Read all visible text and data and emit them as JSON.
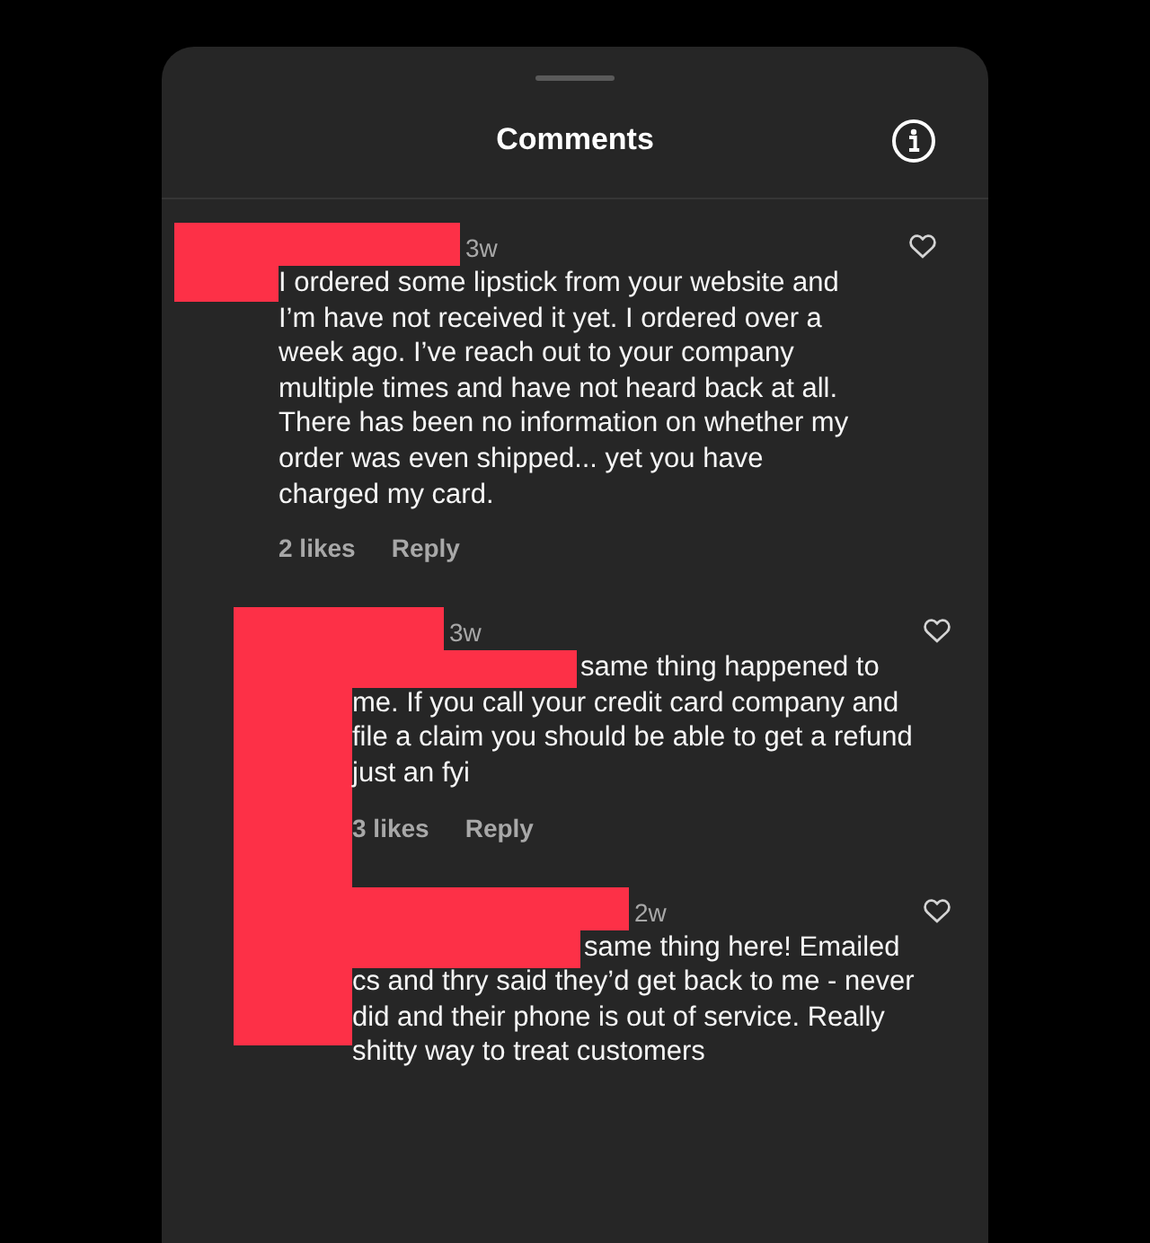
{
  "header": {
    "title": "Comments"
  },
  "comments": [
    {
      "time": "3w",
      "text": "I ordered some lipstick from your website and I’m have not received it yet. I ordered over a week ago. I’ve reach out to your company multiple times and have not heard back at all. There has been no information on whether my order was even shipped... yet you have charged my card.",
      "likes": "2 likes",
      "reply": "Reply",
      "liked": false,
      "replies": [
        {
          "time": "3w",
          "mention_redacted": true,
          "text": "same thing happened to me. If you call your credit card company and file a claim you should be able to get a refund just an fyi",
          "likes": "3 likes",
          "reply": "Reply",
          "liked": false
        },
        {
          "time": "2w",
          "mention_redacted": true,
          "text": "same thing here! Emailed cs and thry said they’d get back to me - never did and their phone is out of service. Really shitty way to treat customers",
          "liked": false
        }
      ]
    }
  ]
}
